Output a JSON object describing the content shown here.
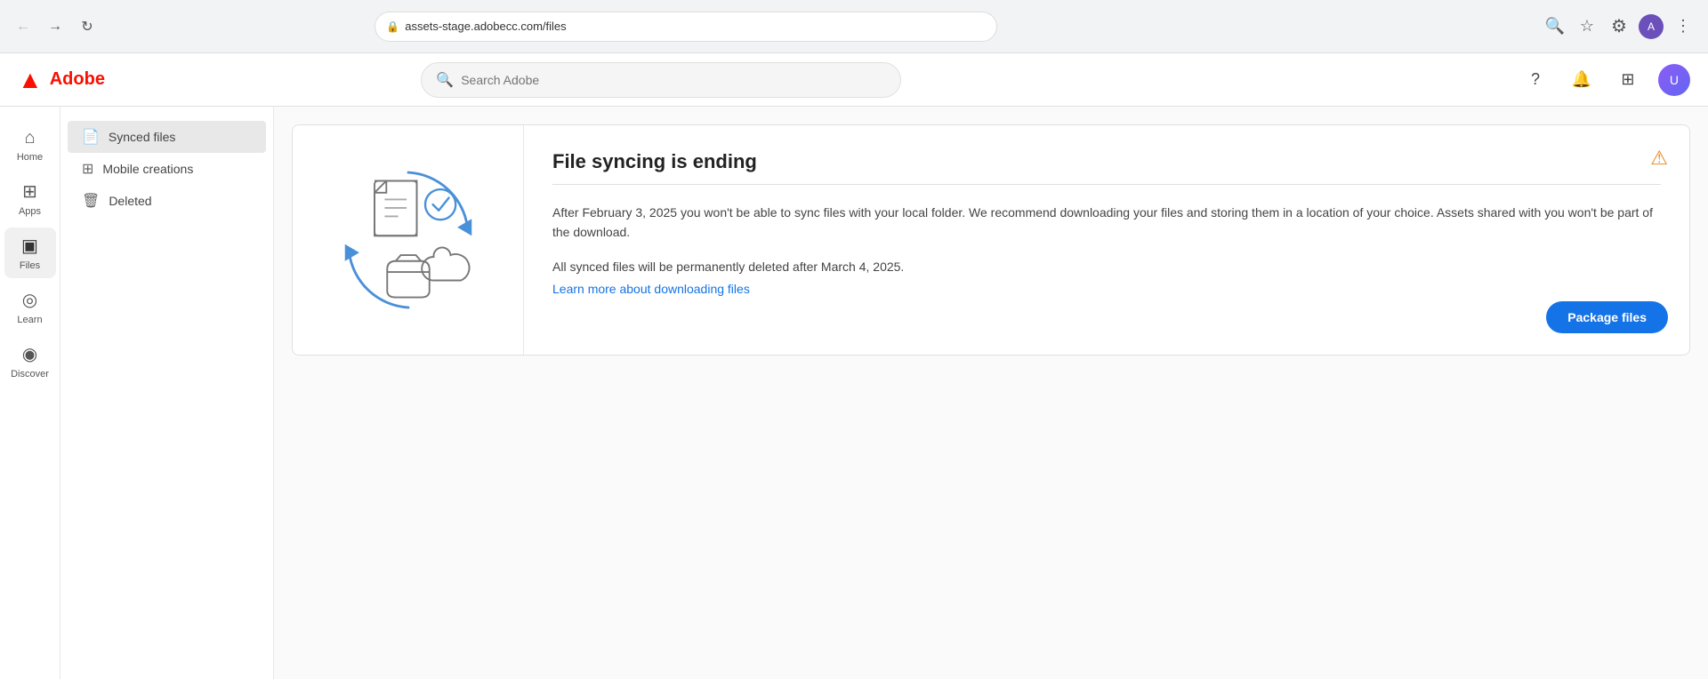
{
  "browser": {
    "url": "assets-stage.adobecc.com/files",
    "back_disabled": false,
    "forward_disabled": false
  },
  "header": {
    "logo_text": "Adobe",
    "search_placeholder": "Search Adobe"
  },
  "icon_sidebar": {
    "items": [
      {
        "id": "home",
        "label": "Home",
        "icon": "⌂",
        "active": false
      },
      {
        "id": "apps",
        "label": "Apps",
        "icon": "⊞",
        "active": false
      },
      {
        "id": "files",
        "label": "Files",
        "icon": "▣",
        "active": true
      },
      {
        "id": "learn",
        "label": "Learn",
        "icon": "◎",
        "active": false
      },
      {
        "id": "discover",
        "label": "Discover",
        "icon": "◉",
        "active": false
      }
    ]
  },
  "file_sidebar": {
    "items": [
      {
        "id": "synced",
        "label": "Synced files",
        "icon": "📄",
        "active": true
      },
      {
        "id": "mobile",
        "label": "Mobile creations",
        "icon": "⊞",
        "active": false
      },
      {
        "id": "deleted",
        "label": "Deleted",
        "icon": "🗑",
        "active": false
      }
    ]
  },
  "banner": {
    "title": "File syncing is ending",
    "body1": "After February 3, 2025 you won't be able to sync files with your local folder. We recommend downloading your files and storing them in a location of your choice. Assets shared with you won't be part of the download.",
    "body2": "All synced files will be permanently deleted after March 4, 2025.",
    "link_text": "Learn more about downloading files",
    "package_btn": "Package files"
  }
}
